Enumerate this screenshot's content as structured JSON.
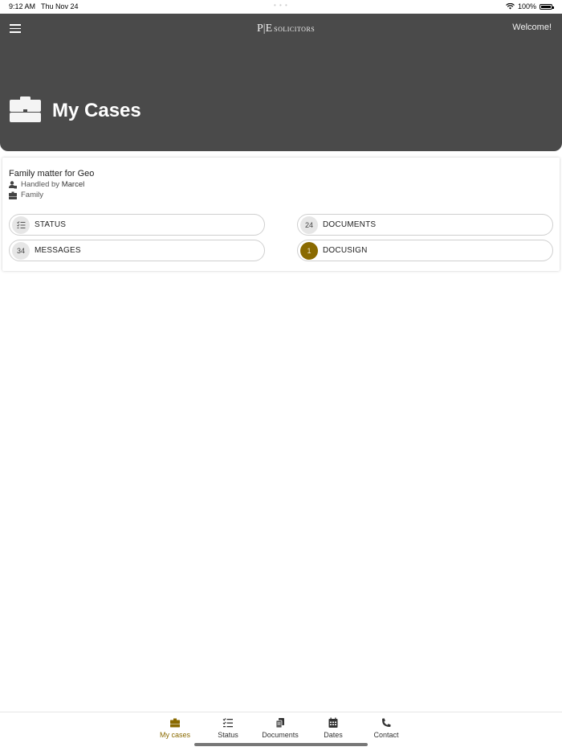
{
  "status_bar": {
    "time": "9:12 AM",
    "date": "Thu Nov 24",
    "battery": "100%"
  },
  "header": {
    "logo_mark": "P|E",
    "logo_word": "SOLICITORS",
    "welcome": "Welcome!",
    "title": "My Cases",
    "icon": "briefcase-icon",
    "background_color": "#4a4a4a"
  },
  "case": {
    "title": "Family matter for Geo",
    "handled_prefix": "Handled by",
    "handler": "Marcel",
    "category": "Family",
    "buttons": {
      "status": {
        "label": "STATUS",
        "icon": "checklist-icon"
      },
      "documents": {
        "label": "DOCUMENTS",
        "count": "24"
      },
      "messages": {
        "label": "MESSAGES",
        "count": "34"
      },
      "docusign": {
        "label": "DOCUSIGN",
        "count": "1",
        "badge_color": "#8a6a00"
      }
    }
  },
  "bottom_nav": {
    "active_color": "#8a6a00",
    "items": [
      {
        "label": "My cases",
        "icon": "briefcase-icon",
        "active": true
      },
      {
        "label": "Status",
        "icon": "checklist-icon",
        "active": false
      },
      {
        "label": "Documents",
        "icon": "documents-icon",
        "active": false
      },
      {
        "label": "Dates",
        "icon": "calendar-icon",
        "active": false
      },
      {
        "label": "Contact",
        "icon": "phone-icon",
        "active": false
      }
    ]
  }
}
